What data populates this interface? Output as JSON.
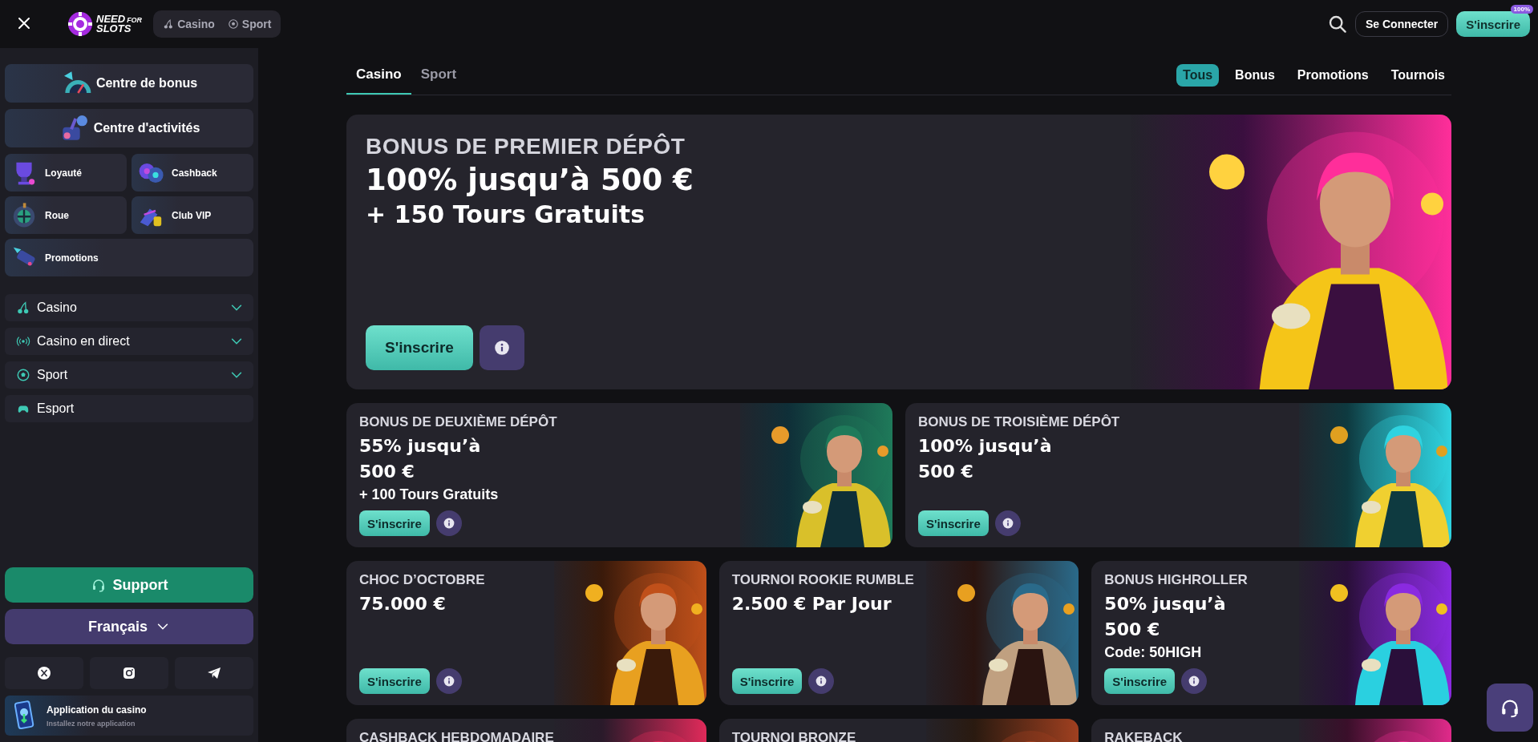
{
  "header": {
    "logo": {
      "word_1": "NEED",
      "word_2": "FOR",
      "word_3": "SLOTS"
    },
    "mode_switch": [
      {
        "label": "Casino",
        "selected": false
      },
      {
        "label": "Sport",
        "selected": false
      }
    ],
    "login_button": "Se Connecter",
    "signup_button": {
      "label": "S'inscrire",
      "badge": "100%"
    }
  },
  "sidebar": {
    "featured": [
      {
        "label": "Centre de bonus"
      },
      {
        "label": "Centre d'activités"
      }
    ],
    "grid": [
      {
        "label": "Loyauté"
      },
      {
        "label": "Cashback"
      },
      {
        "label": "Roue"
      },
      {
        "label": "Club VIP"
      },
      {
        "label": "Promotions"
      }
    ],
    "nav": [
      {
        "label": "Casino",
        "expandable": true
      },
      {
        "label": "Casino en direct",
        "expandable": true
      },
      {
        "label": "Sport",
        "expandable": true
      },
      {
        "label": "Esport",
        "expandable": false
      }
    ],
    "support_button": "Support",
    "language": "Français",
    "app": {
      "title": "Application du casino",
      "subtitle": "Installez notre application"
    }
  },
  "main": {
    "tabs": [
      {
        "label": "Casino",
        "selected": true
      },
      {
        "label": "Sport",
        "selected": false
      }
    ],
    "filters": [
      {
        "label": "Tous",
        "selected": true
      },
      {
        "label": "Bonus",
        "selected": false
      },
      {
        "label": "Promotions",
        "selected": false
      },
      {
        "label": "Tournois",
        "selected": false
      }
    ],
    "hero": {
      "title": "BONUS DE PREMIER DÉPÔT",
      "headline": "100% jusqu’à 500 €",
      "subline": "+ 150 Tours Gratuits",
      "button": "S'inscrire"
    },
    "rows": [
      [
        {
          "title": "BONUS DE DEUXIÈME DÉPÔT",
          "lines": [
            {
              "kind": "headline",
              "text": "55% jusqu’à"
            },
            {
              "kind": "headline",
              "text": "500 €"
            },
            {
              "kind": "detail",
              "text": "+ 100 Tours Gratuits"
            }
          ],
          "button": "S'inscrire"
        },
        {
          "title": "BONUS DE TROISIÈME DÉPÔT",
          "lines": [
            {
              "kind": "headline",
              "text": "100% jusqu’à"
            },
            {
              "kind": "headline",
              "text": "500 €"
            }
          ],
          "button": "S'inscrire"
        }
      ],
      [
        {
          "title": "CHOC D’OCTOBRE",
          "lines": [
            {
              "kind": "headline",
              "text": "75.000 €"
            }
          ],
          "button": "S'inscrire"
        },
        {
          "title": "TOURNOI ROOKIE RUMBLE",
          "lines": [
            {
              "kind": "headline",
              "text": "2.500 € Par Jour"
            }
          ],
          "button": "S'inscrire"
        },
        {
          "title": "BONUS HIGHROLLER",
          "lines": [
            {
              "kind": "headline",
              "text": "50% jusqu’à"
            },
            {
              "kind": "headline",
              "text": "500 €"
            },
            {
              "kind": "detail",
              "text": "Code: 50HIGH"
            }
          ],
          "button": "S'inscrire"
        }
      ],
      [
        {
          "title": "CASHBACK HEBDOMADAIRE"
        },
        {
          "title": "TOURNOI BRONZE"
        },
        {
          "title": "RAKEBACK"
        }
      ]
    ]
  }
}
